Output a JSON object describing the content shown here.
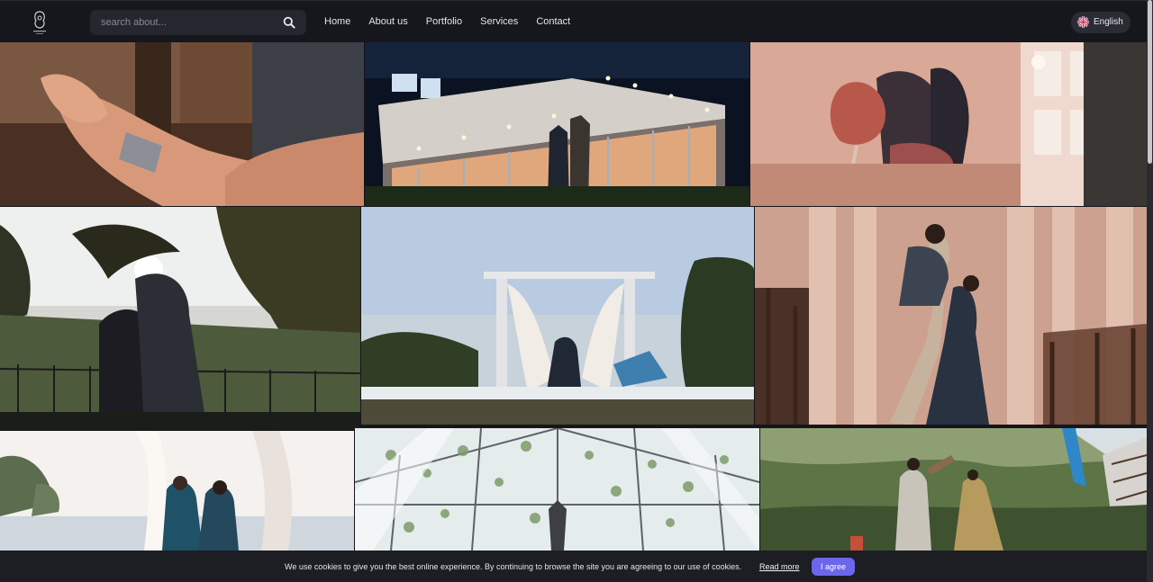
{
  "search": {
    "placeholder": "search about..."
  },
  "nav": {
    "items": [
      {
        "label": "Home"
      },
      {
        "label": "About us"
      },
      {
        "label": "Portfolio"
      },
      {
        "label": "Services"
      },
      {
        "label": "Contact"
      }
    ],
    "language": "English"
  },
  "gallery": {
    "items": [
      {
        "subject": "hands-with-bracelet"
      },
      {
        "subject": "couple-at-lit-house-night"
      },
      {
        "subject": "couple-with-tulip"
      },
      {
        "subject": "couple-palm-trees-sunset"
      },
      {
        "subject": "pergola-woman-evening"
      },
      {
        "subject": "couple-dancing-curtains"
      },
      {
        "subject": "couple-seated-curtains"
      },
      {
        "subject": "glass-roof-vines"
      },
      {
        "subject": "couple-dancing-garden"
      }
    ]
  },
  "cookie": {
    "message": "We use cookies to give you the best online experience. By continuing to browse the site you are agreeing to our use of cookies.",
    "read_more": "Read more",
    "accept": "I agree"
  },
  "colors": {
    "accent": "#6a67ea",
    "nav_bg": "#16161d"
  }
}
